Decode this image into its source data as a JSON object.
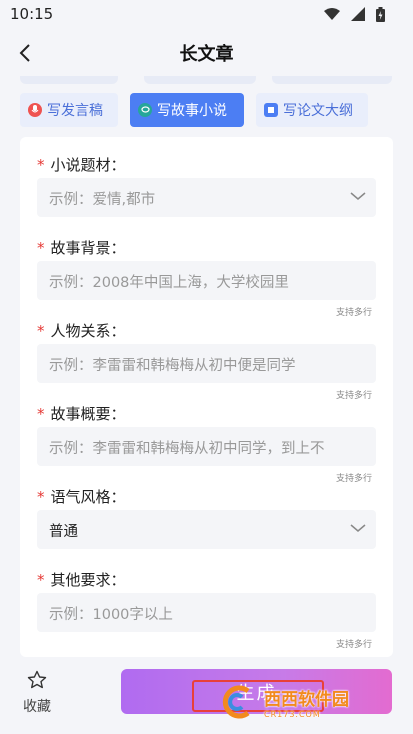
{
  "status_bar": {
    "time": "10:15"
  },
  "header": {
    "title": "长文章"
  },
  "tabs": [
    {
      "label": "写发言稿",
      "icon": "microphone-icon",
      "color": "#ef5350"
    },
    {
      "label": "写故事小说",
      "icon": "chat-icon",
      "color": "#26a69a",
      "active": true
    },
    {
      "label": "写论文大纲",
      "icon": "book-icon",
      "color": "#4c7ef3"
    }
  ],
  "form": {
    "fields": [
      {
        "label": "小说题材：",
        "value": "示例：爱情,都市",
        "type": "select"
      },
      {
        "label": "故事背景：",
        "value": "示例：2008年中国上海，大学校园里",
        "type": "textarea",
        "hint": "支持多行"
      },
      {
        "label": "人物关系：",
        "value": "示例：李雷雷和韩梅梅从初中便是同学",
        "type": "textarea",
        "hint": "支持多行"
      },
      {
        "label": "故事概要：",
        "value": "示例：李雷雷和韩梅梅从初中同学，到上不",
        "type": "textarea",
        "hint": "支持多行"
      },
      {
        "label": "语气风格：",
        "value": "普通",
        "type": "select"
      },
      {
        "label": "其他要求：",
        "value": "示例：1000字以上",
        "type": "textarea",
        "hint": "支持多行"
      }
    ],
    "required_mark": "*"
  },
  "bottom_bar": {
    "favorite_label": "收藏",
    "generate_label": "生成"
  },
  "watermark": {
    "text": "西西软件园",
    "sub": "CR173.COM"
  },
  "colors": {
    "accent": "#4c7ef3",
    "required": "#e53935",
    "generate_start": "#b06bf0",
    "generate_end": "#e36bd0",
    "highlight": "#e8403a"
  }
}
